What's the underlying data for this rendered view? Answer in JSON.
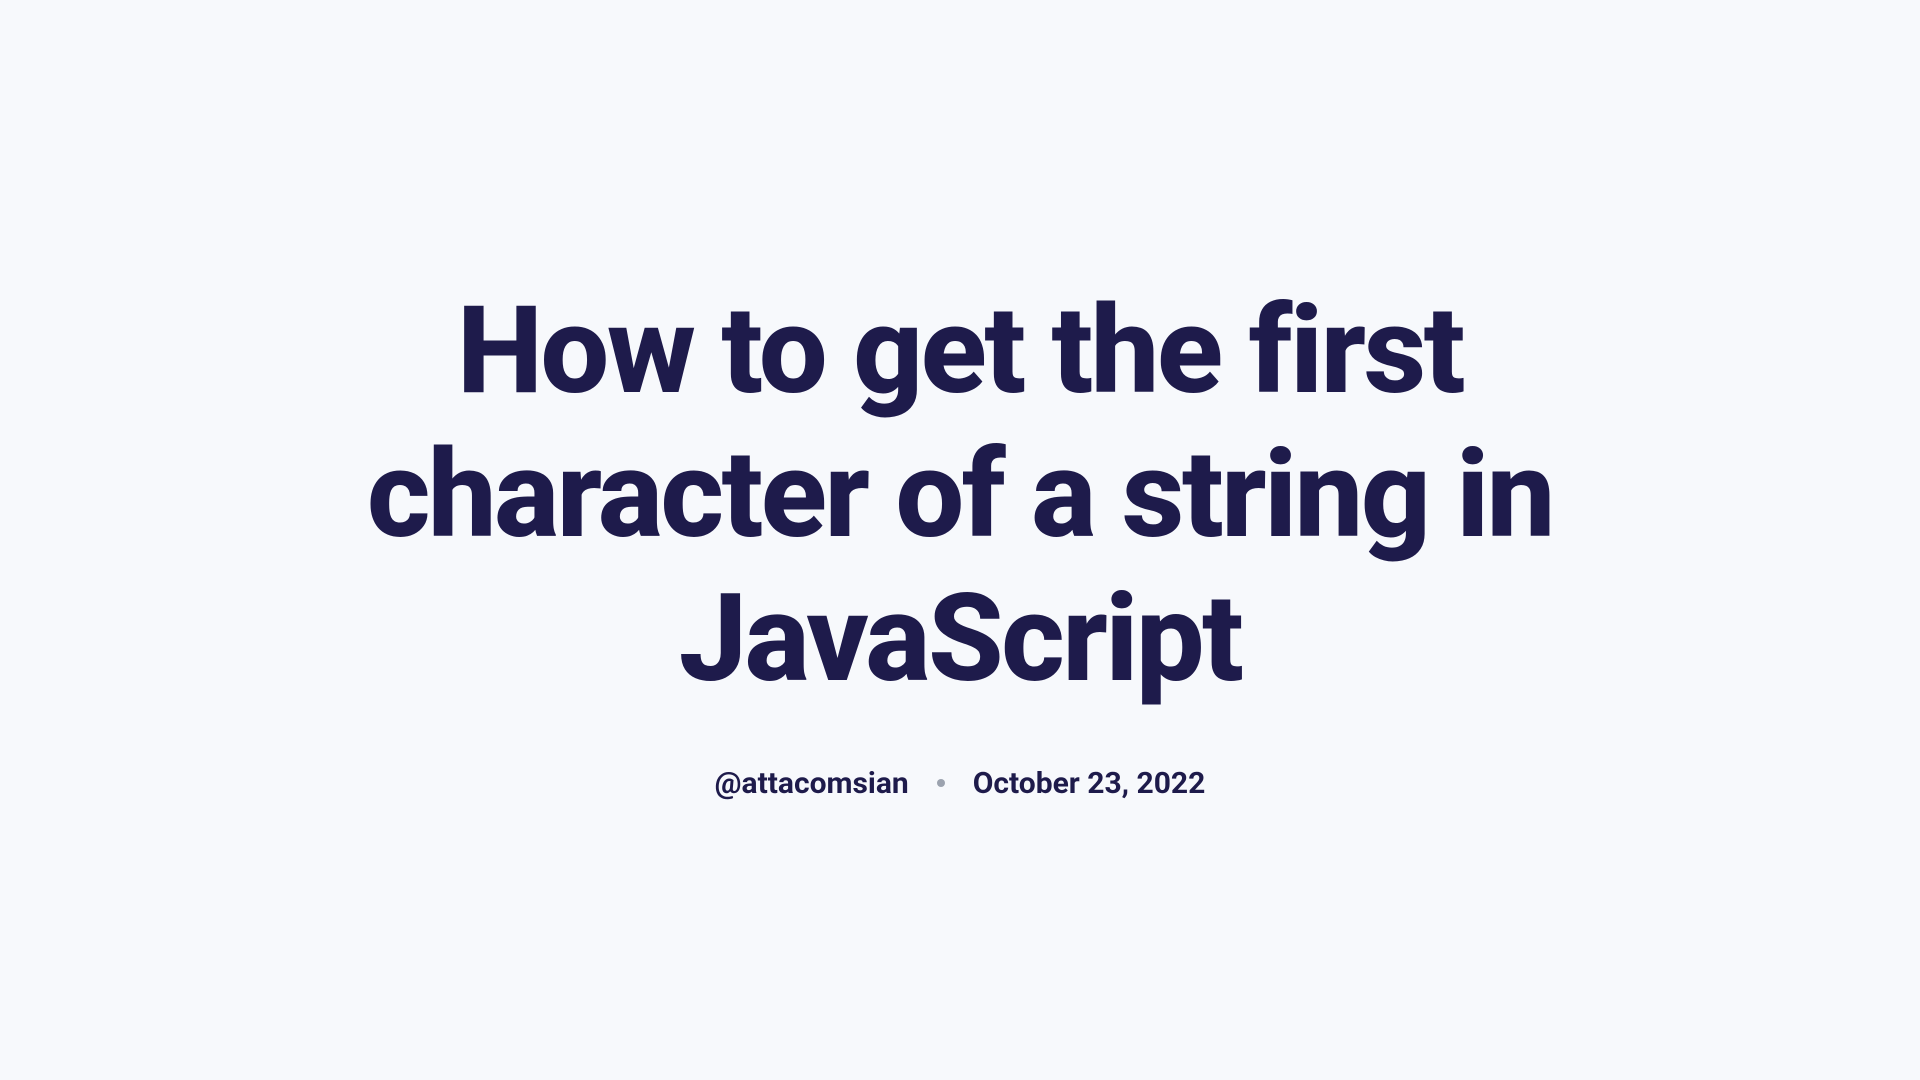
{
  "article": {
    "title": "How to get the first character of a string in JavaScript",
    "author": "@attacomsian",
    "date": "October 23, 2022"
  }
}
